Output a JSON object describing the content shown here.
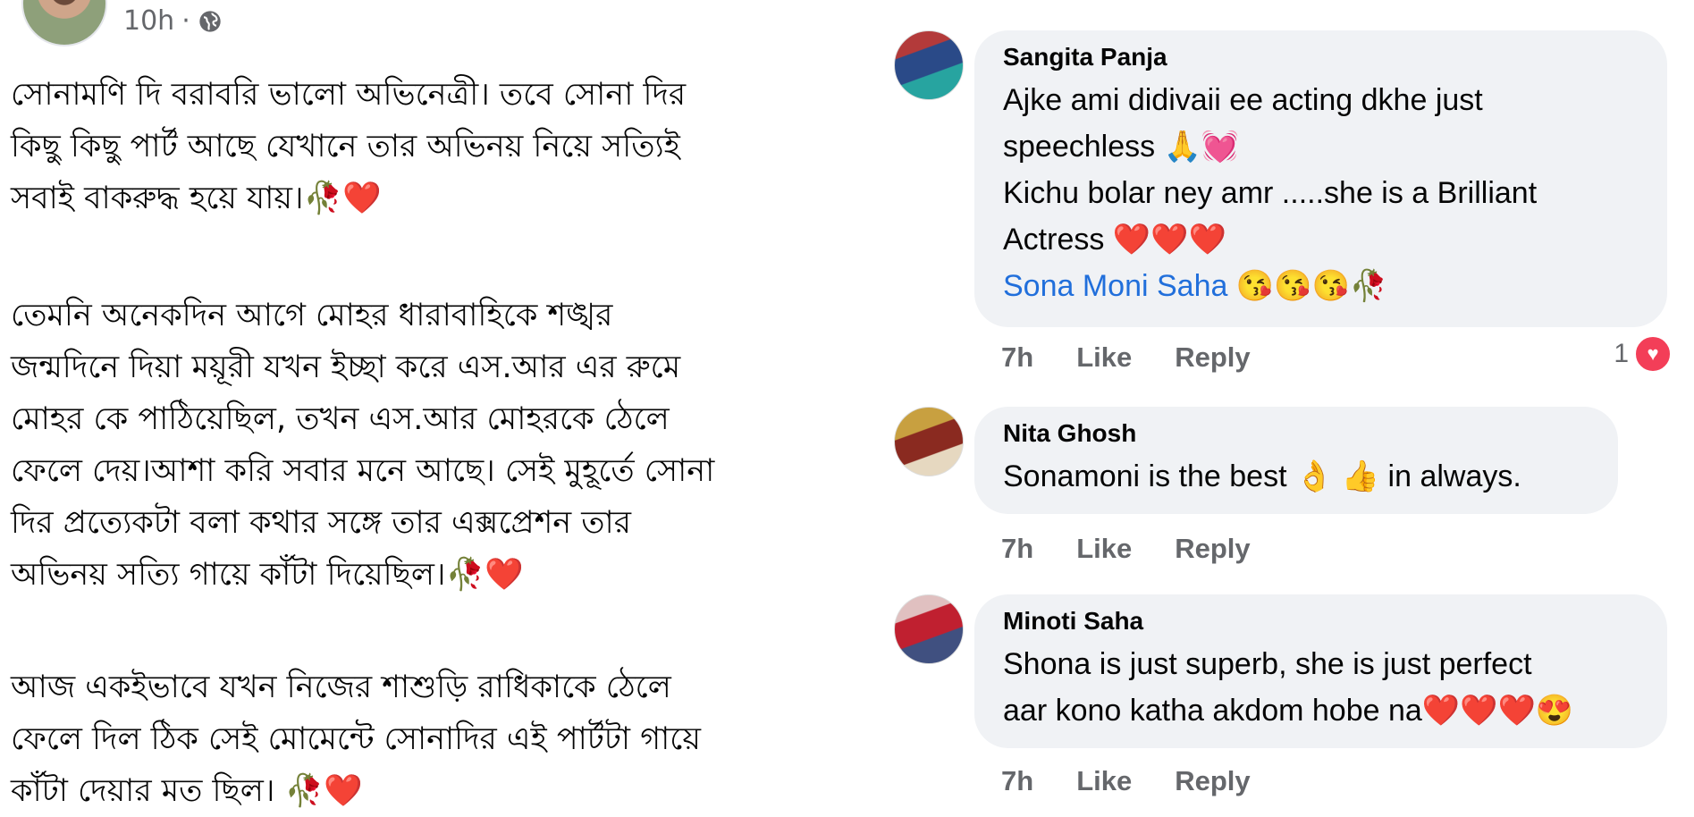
{
  "post": {
    "time": "10h",
    "separator": "·",
    "globe_icon": "globe-icon",
    "paragraphs": [
      "সোনামণি দি বরাবরি ভালো অভিনেত্রী। তবে সোনা দির\nকিছু কিছু পার্ট আছে যেখানে তার অভিনয় নিয়ে সত্যিই\nসবাই বাকরুদ্ধ হয়ে যায়।🥀❤️",
      "তেমনি অনেকদিন আগে মোহর ধারাবাহিকে শঙ্খর\nজন্মদিনে দিয়া ময়ূরী যখন ইচ্ছা করে এস.আর এর রুমে\nমোহর কে পাঠিয়েছিল, তখন এস.আর মোহরকে ঠেলে\nফেলে দেয়।আশা করি সবার মনে আছে। সেই মুহূর্তে সোনা\nদির প্রত্যেকটা বলা কথার সঙ্গে তার এক্সপ্রেশন তার\nঅভিনয় সত্যি গায়ে কাঁটা দিয়েছিল।🥀❤️",
      "আজ একইভাবে যখন নিজের শাশুড়ি রাধিকাকে ঠেলে\nফেলে দিল ঠিক সেই মোমেন্টে সোনাদির এই পার্টটা গায়ে\nকাঁটা দেয়ার মত ছিল। 🥀❤️"
    ]
  },
  "comments": [
    {
      "name": "Sangita Panja",
      "text_lines": [
        "Ajke ami didivaii ee acting dkhe just",
        "speechless 🙏💓",
        "Kichu bolar ney amr .....she is a Brilliant",
        "Actress ❤️❤️❤️"
      ],
      "mention": "Sona Moni Saha",
      "mention_suffix": " 😘😘😘🥀",
      "time": "7h",
      "like": "Like",
      "reply": "Reply",
      "reaction_count": "1"
    },
    {
      "name": "Nita Ghosh",
      "text_lines": [
        "Sonamoni is the best 👌 👍 in always."
      ],
      "time": "7h",
      "like": "Like",
      "reply": "Reply"
    },
    {
      "name": "Minoti Saha",
      "text_lines": [
        "Shona is just superb, she is just perfect",
        "aar kono katha akdom hobe na❤️❤️❤️😍"
      ],
      "time": "7h",
      "like": "Like",
      "reply": "Reply"
    }
  ]
}
